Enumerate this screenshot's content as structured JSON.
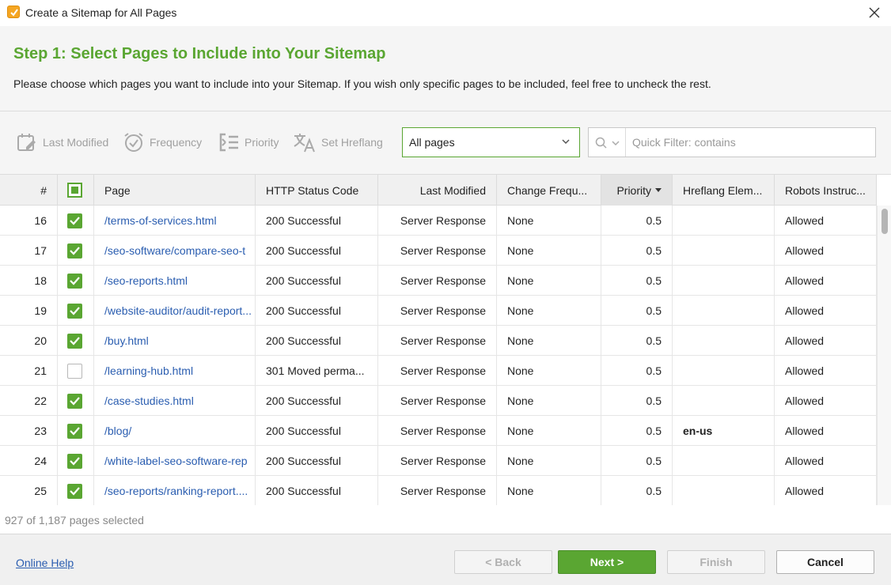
{
  "window": {
    "title": "Create a Sitemap for All Pages",
    "icon": "app-check-icon"
  },
  "header": {
    "step_title": "Step 1: Select Pages to Include into Your Sitemap",
    "description": "Please choose which pages you want to include into your Sitemap. If you wish only specific pages to be included, feel free to uncheck the rest."
  },
  "toolbar": {
    "last_modified": "Last Modified",
    "frequency": "Frequency",
    "priority": "Priority",
    "set_hreflang": "Set Hreflang",
    "filter_value": "All pages",
    "quick_filter_placeholder": "Quick Filter: contains"
  },
  "table": {
    "columns": {
      "num": "#",
      "page": "Page",
      "http_status": "HTTP Status Code",
      "last_modified": "Last Modified",
      "change_freq": "Change Frequ...",
      "priority": "Priority",
      "hreflang": "Hreflang Elem...",
      "robots": "Robots Instruc..."
    },
    "sorted_column": "priority",
    "rows": [
      {
        "num": "16",
        "checked": true,
        "page": "/terms-of-services.html",
        "status": "200 Successful",
        "modified": "Server Response",
        "freq": "None",
        "priority": "0.5",
        "hreflang": "",
        "robots": "Allowed"
      },
      {
        "num": "17",
        "checked": true,
        "page": "/seo-software/compare-seo-t",
        "status": "200 Successful",
        "modified": "Server Response",
        "freq": "None",
        "priority": "0.5",
        "hreflang": "",
        "robots": "Allowed"
      },
      {
        "num": "18",
        "checked": true,
        "page": "/seo-reports.html",
        "status": "200 Successful",
        "modified": "Server Response",
        "freq": "None",
        "priority": "0.5",
        "hreflang": "",
        "robots": "Allowed"
      },
      {
        "num": "19",
        "checked": true,
        "page": "/website-auditor/audit-report...",
        "status": "200 Successful",
        "modified": "Server Response",
        "freq": "None",
        "priority": "0.5",
        "hreflang": "",
        "robots": "Allowed"
      },
      {
        "num": "20",
        "checked": true,
        "page": "/buy.html",
        "status": "200 Successful",
        "modified": "Server Response",
        "freq": "None",
        "priority": "0.5",
        "hreflang": "",
        "robots": "Allowed"
      },
      {
        "num": "21",
        "checked": false,
        "page": "/learning-hub.html",
        "status": "301 Moved perma...",
        "modified": "Server Response",
        "freq": "None",
        "priority": "0.5",
        "hreflang": "",
        "robots": "Allowed"
      },
      {
        "num": "22",
        "checked": true,
        "page": "/case-studies.html",
        "status": "200 Successful",
        "modified": "Server Response",
        "freq": "None",
        "priority": "0.5",
        "hreflang": "",
        "robots": "Allowed"
      },
      {
        "num": "23",
        "checked": true,
        "page": "/blog/",
        "status": "200 Successful",
        "modified": "Server Response",
        "freq": "None",
        "priority": "0.5",
        "hreflang": "en-us",
        "robots": "Allowed"
      },
      {
        "num": "24",
        "checked": true,
        "page": "/white-label-seo-software-rep",
        "status": "200 Successful",
        "modified": "Server Response",
        "freq": "None",
        "priority": "0.5",
        "hreflang": "",
        "robots": "Allowed"
      },
      {
        "num": "25",
        "checked": true,
        "page": "/seo-reports/ranking-report....",
        "status": "200 Successful",
        "modified": "Server Response",
        "freq": "None",
        "priority": "0.5",
        "hreflang": "",
        "robots": "Allowed"
      }
    ]
  },
  "status": {
    "selection": "927 of 1,187 pages selected"
  },
  "footer": {
    "help": "Online Help",
    "back": "< Back",
    "next": "Next >",
    "finish": "Finish",
    "cancel": "Cancel"
  },
  "colors": {
    "accent": "#5aa632",
    "link": "#2a5db0"
  }
}
